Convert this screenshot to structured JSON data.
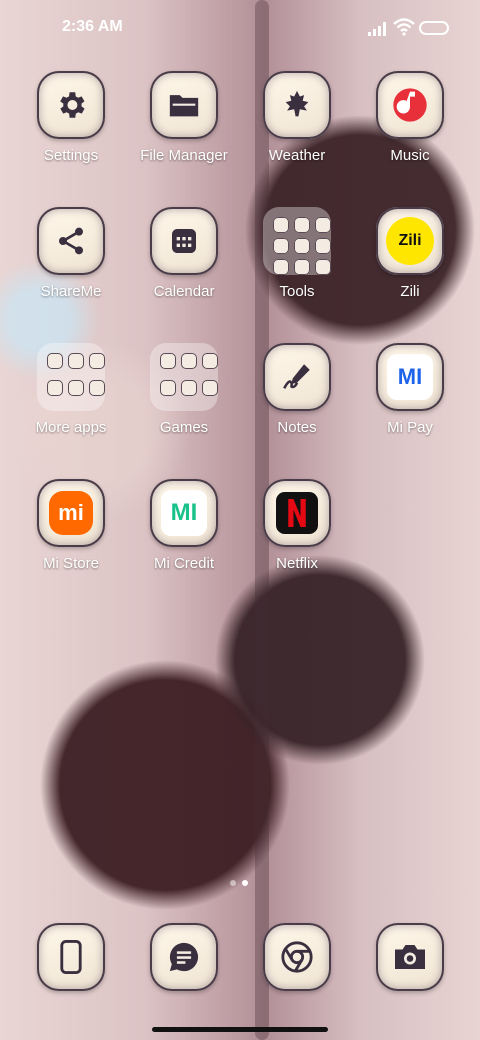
{
  "status": {
    "time": "2:36 AM"
  },
  "apps": [
    {
      "label": "Settings"
    },
    {
      "label": "File Manager"
    },
    {
      "label": "Weather"
    },
    {
      "label": "Music"
    },
    {
      "label": "ShareMe"
    },
    {
      "label": "Calendar"
    },
    {
      "label": "Tools"
    },
    {
      "label": "Zili"
    },
    {
      "label": "More apps"
    },
    {
      "label": "Games"
    },
    {
      "label": "Notes"
    },
    {
      "label": "Mi Pay"
    },
    {
      "label": "Mi Store"
    },
    {
      "label": "Mi Credit"
    },
    {
      "label": "Netflix"
    }
  ],
  "tile_texts": {
    "zili": "Zili",
    "mi_pay": "MI",
    "mi_store": "mi",
    "mi_credit": "MI"
  },
  "dock": [
    {
      "icon": "phone-icon"
    },
    {
      "icon": "messages-icon"
    },
    {
      "icon": "chrome-icon"
    },
    {
      "icon": "camera-icon"
    }
  ],
  "colors": {
    "icon_dark": "#3a2f3f",
    "mi_orange": "#ff6900",
    "netflix_red": "#e50914",
    "music_red": "#e8303a",
    "mi_credit_green": "#19c28a"
  }
}
